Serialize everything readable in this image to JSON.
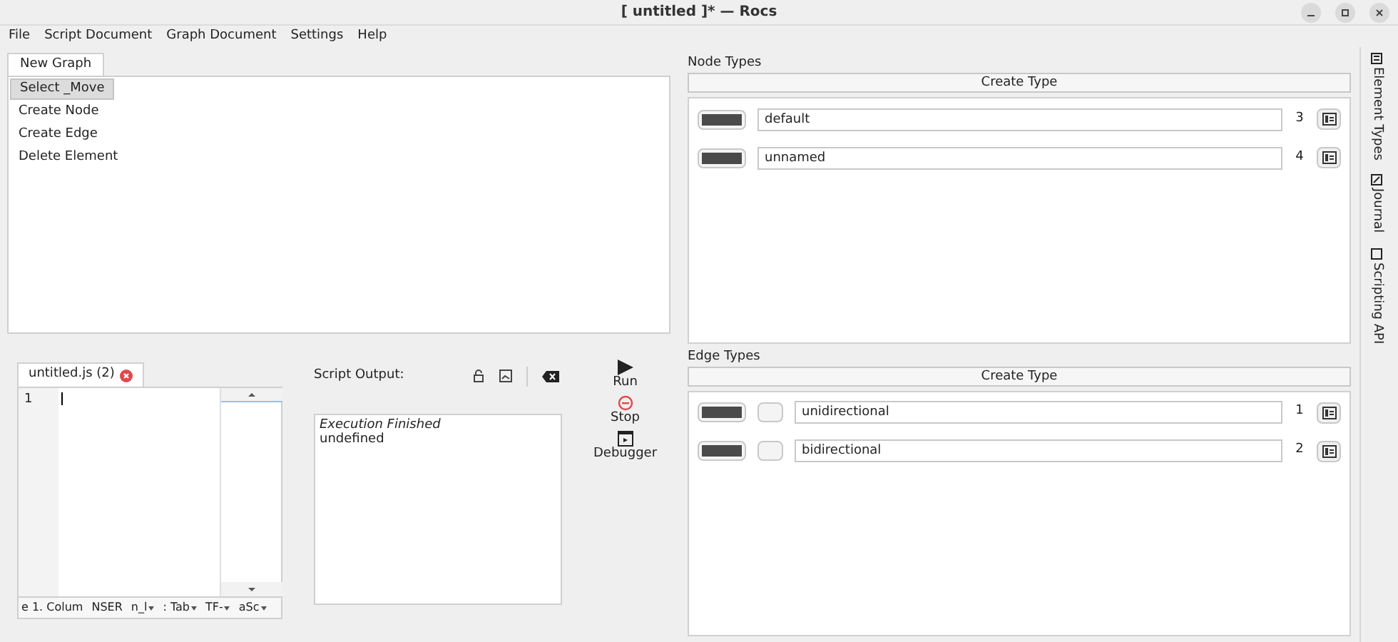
{
  "window": {
    "title": "[ untitled ]* — Rocs"
  },
  "menu": [
    "File",
    "Script Document",
    "Graph Document",
    "Settings",
    "Help"
  ],
  "graph_tabs": [
    {
      "label": "New Graph",
      "selected": true
    }
  ],
  "graph_tools": [
    {
      "label": "Select _Move",
      "selected": true
    },
    {
      "label": "Create Node",
      "selected": false
    },
    {
      "label": "Create Edge",
      "selected": false
    },
    {
      "label": "Delete Element",
      "selected": false
    }
  ],
  "editor": {
    "tab": "untitled.js (2)",
    "line_numbers": [
      "1"
    ],
    "status": [
      {
        "text": "e 1. Colum",
        "dropdown": false
      },
      {
        "text": "NSER",
        "dropdown": false
      },
      {
        "text": "n_l",
        "dropdown": true
      },
      {
        "text": ": Tab",
        "dropdown": true
      },
      {
        "text": "TF-",
        "dropdown": true
      },
      {
        "text": "aSc",
        "dropdown": true
      }
    ]
  },
  "script_output": {
    "label": "Script Output:",
    "lines": [
      {
        "text": "Execution Finished",
        "italic": true
      },
      {
        "text": "undefined",
        "italic": false
      }
    ]
  },
  "actions": [
    {
      "kind": "run",
      "label": "Run"
    },
    {
      "kind": "stop",
      "label": "Stop"
    },
    {
      "kind": "debugger",
      "label": "Debugger"
    }
  ],
  "node_types": {
    "title": "Node Types",
    "button": "Create Type",
    "items": [
      {
        "color": "#4a4a4a",
        "name": "default",
        "id": "3"
      },
      {
        "color": "#4a4a4a",
        "name": "unnamed",
        "id": "4"
      }
    ]
  },
  "edge_types": {
    "title": "Edge Types",
    "button": "Create Type",
    "items": [
      {
        "color": "#4a4a4a",
        "name": "unidirectional",
        "id": "1"
      },
      {
        "color": "#4a4a4a",
        "name": "bidirectional",
        "id": "2"
      }
    ]
  },
  "side_tabs": [
    {
      "kind": "types",
      "label": "Element Types"
    },
    {
      "kind": "journal",
      "label": "Journal"
    },
    {
      "kind": "api",
      "label": "Scripting API"
    }
  ]
}
